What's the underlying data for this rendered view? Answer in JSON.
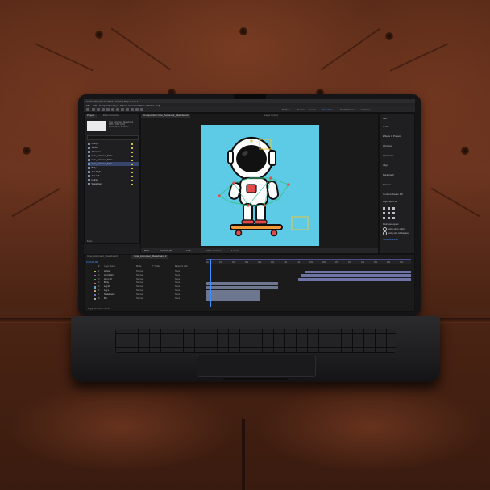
{
  "app": {
    "title_bar": "Adobe After Effects 2024 - Untitled Project.aep *",
    "menu": [
      "File",
      "Edit",
      "Composition",
      "Layer",
      "Effect",
      "Animation",
      "View",
      "Window",
      "Help"
    ],
    "workspaces": [
      "Default",
      "Review",
      "Learn",
      "Standard",
      "Small Screen",
      "Libraries"
    ],
    "active_workspace": "Standard"
  },
  "project_panel": {
    "tabs": [
      "Project",
      "Effect Controls"
    ],
    "info": [
      "Cute_Astronaut_Skateboard",
      "1080 x 1080 (1.00)",
      "Δ 0;00;10;00, 30.00 fps"
    ],
    "items": [
      {
        "name": "Comp 1",
        "sel": false
      },
      {
        "name": "Solids",
        "sel": false
      },
      {
        "name": "Astronaut",
        "sel": false
      },
      {
        "name": "Cute_Astronaut_Skate",
        "sel": false
      },
      {
        "name": "Cute_Astronaut_Skate",
        "sel": false
      },
      {
        "name": "Cute_Astronaut_Skate",
        "sel": true
      },
      {
        "name": "Body",
        "sel": false
      },
      {
        "name": "Arm Right",
        "sel": false
      },
      {
        "name": "Arm Left",
        "sel": false
      },
      {
        "name": "Helmet",
        "sel": false
      },
      {
        "name": "Skateboard",
        "sel": false
      }
    ],
    "bpc": "8 bpc"
  },
  "composition_panel": {
    "tab": "Composition Cute_Astronaut_Skateboard",
    "layer_tab": "Layer (none)",
    "zoom": "50%",
    "timecode": "0;00;00;00",
    "resolution": "Half",
    "camera": "Active Camera",
    "view": "1 View"
  },
  "right_panel": {
    "items": [
      "Info",
      "Audio",
      "Effects & Presets",
      "Libraries",
      "Character",
      "Align",
      "Paragraph",
      "Tracker",
      "Content-Aware Fill"
    ],
    "align_label": "Align Layers to:",
    "align_target": "Selection",
    "distribute_label": "Distribute Layers:",
    "radio_1": "Justify when editing",
    "radio_2": "Justify with whitespace",
    "more_link": "Show Advanced"
  },
  "timeline": {
    "tabs": [
      "Cute_Astronaut_Skateboard",
      "Cute_Astronaut_Skateboard 2"
    ],
    "timecode": "0;00;00;00",
    "ruler": [
      "0s",
      "02s",
      "04s",
      "06s",
      "08s",
      "10s",
      "12s",
      "14s",
      "16s",
      "18s",
      "20s",
      "22s",
      "24s",
      "26s",
      "28s",
      "30s"
    ],
    "columns": [
      "#",
      "Layer Name",
      "Mode",
      "T TrkMat",
      "Parent & Link"
    ],
    "layers": [
      {
        "num": "1",
        "name": "Helmet",
        "mode": "Normal",
        "parent": "None",
        "color": "#c7b84a",
        "bar": [
          0.48,
          1.0
        ]
      },
      {
        "num": "2",
        "name": "Arm Right",
        "mode": "Normal",
        "parent": "None",
        "color": "#8f5fbf",
        "bar": [
          0.46,
          1.0
        ]
      },
      {
        "num": "3",
        "name": "Arm Left",
        "mode": "Normal",
        "parent": "None",
        "color": "#4f9c6a",
        "bar": [
          0.45,
          1.0
        ]
      },
      {
        "num": "4",
        "name": "Body",
        "mode": "Normal",
        "parent": "None",
        "color": "#c56a6a",
        "bar": [
          0.0,
          0.35
        ]
      },
      {
        "num": "5",
        "name": "Leg R",
        "mode": "Normal",
        "parent": "None",
        "color": "#6aa3c5",
        "bar": [
          0.0,
          0.35
        ]
      },
      {
        "num": "6",
        "name": "Leg L",
        "mode": "Normal",
        "parent": "None",
        "color": "#c59a6a",
        "bar": [
          0.0,
          0.26
        ]
      },
      {
        "num": "7",
        "name": "Skateboard",
        "mode": "Normal",
        "parent": "None",
        "color": "#6a6ac5",
        "bar": [
          0.0,
          0.26
        ]
      },
      {
        "num": "8",
        "name": "BG",
        "mode": "Normal",
        "parent": "None",
        "color": "#aaaaaa",
        "bar": [
          0.0,
          0.26
        ]
      }
    ],
    "footer": "Toggle Switches / Modes"
  },
  "colors": {
    "canvas_bg": "#5ecbe6",
    "accent": "#3e8eff",
    "panel_bg": "#1f1f21"
  }
}
